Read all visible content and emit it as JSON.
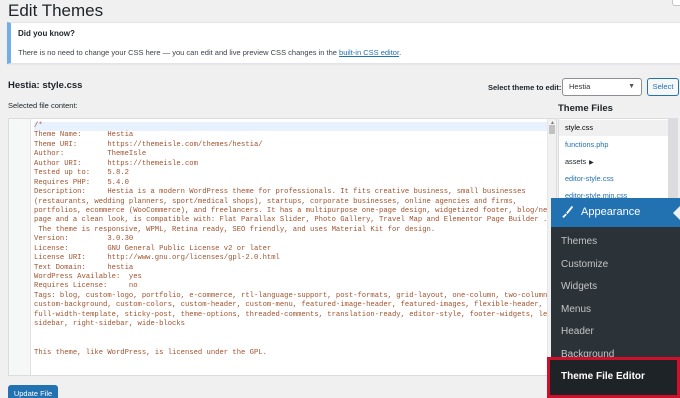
{
  "page": {
    "title": "Edit Themes"
  },
  "notice": {
    "title": "Did you know?",
    "text": "There is no need to change your CSS here — you can edit and live preview CSS changes in the ",
    "link": "built-in CSS editor",
    "suffix": "."
  },
  "editor": {
    "file_heading": "Hestia: style.css",
    "selected_label": "Selected file content:",
    "lines": [
      "/*",
      "Theme Name:      Hestia",
      "Theme URI:       https://themeisle.com/themes/hestia/",
      "Author:          ThemeIsle",
      "Author URI:      https://themeisle.com",
      "Tested up to:    5.8.2",
      "Requires PHP:    5.4.0",
      "Description:     Hestia is a modern WordPress theme for professionals. It fits creative business, small businesses",
      "(restaurants, wedding planners, sport/medical shops), startups, corporate businesses, online agencies and firms,",
      "portfolios, ecommerce (WooCommerce), and freelancers. It has a multipurpose one-page design, widgetized footer, blog/news",
      "page and a clean look, is compatible with: Flat Parallax Slider, Photo Gallery, Travel Map and Elementor Page Builder .",
      " The theme is responsive, WPML, Retina ready, SEO friendly, and uses Material Kit for design.",
      "Version:         3.0.30",
      "License:         GNU General Public License v2 or later",
      "License URI:     http://www.gnu.org/licenses/gpl-2.0.html",
      "Text Domain:     hestia",
      "WordPress Available:  yes",
      "Requires License:     no",
      "Tags: blog, custom-logo, portfolio, e-commerce, rtl-language-support, post-formats, grid-layout, one-column, two-columns,",
      "custom-background, custom-colors, custom-header, custom-menu, featured-image-header, featured-images, flexible-header,",
      "full-width-template, sticky-post, theme-options, threaded-comments, translation-ready, editor-style, footer-widgets, left-",
      "sidebar, right-sidebar, wide-blocks",
      "",
      "",
      "This theme, like WordPress, is licensed under the GPL."
    ],
    "update_button": "Update File"
  },
  "theme_select": {
    "label": "Select theme to edit:",
    "value": "Hestia",
    "button": "Select"
  },
  "theme_files": {
    "title": "Theme Files",
    "items": [
      {
        "label": "style.css",
        "type": "file",
        "active": true
      },
      {
        "label": "functions.php",
        "type": "file",
        "active": false
      },
      {
        "label": "assets",
        "type": "folder",
        "active": false
      },
      {
        "label": "editor-style.css",
        "type": "file",
        "active": false
      },
      {
        "label": "editor-style.min.css",
        "type": "file",
        "active": false
      }
    ]
  },
  "appearance_menu": {
    "header": "Appearance",
    "header_icon": "paintbrush-icon",
    "items": [
      "Themes",
      "Customize",
      "Widgets",
      "Menus",
      "Header",
      "Background"
    ],
    "highlighted": "Theme File Editor",
    "accent_color": "#2271b1",
    "highlight_border_color": "#d0102a"
  }
}
